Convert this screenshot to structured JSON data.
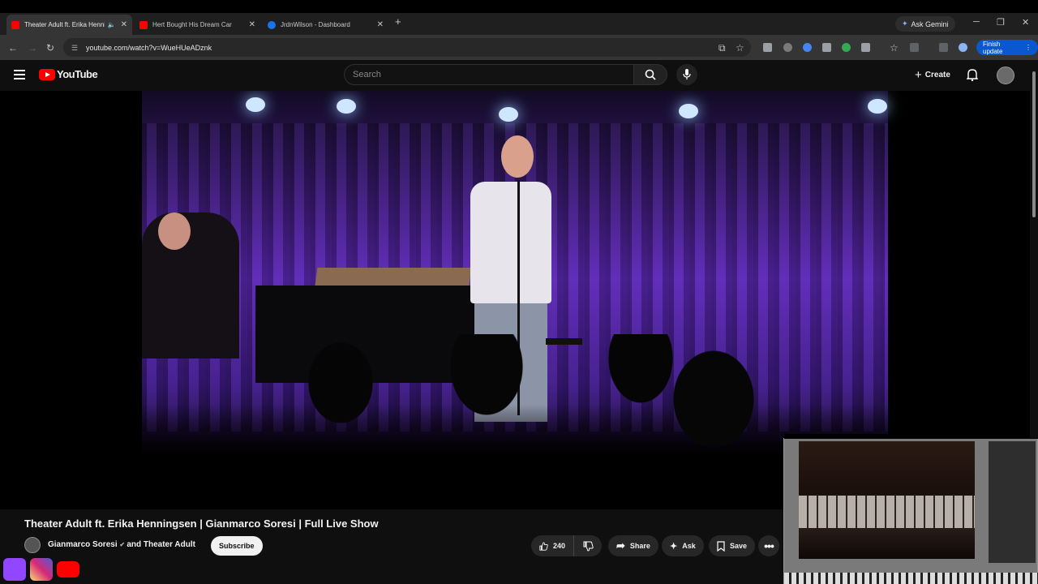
{
  "browser": {
    "tabs": [
      {
        "title": "Theater Adult ft. Erika Henningsen",
        "color": "#ff0000"
      },
      {
        "title": "Hert Bought His Dream Car",
        "color": "#ff0000"
      },
      {
        "title": "JrdnWilson - Dashboard",
        "color": "#1a73e8"
      }
    ],
    "ask_gemini": "Ask Gemini",
    "url": "youtube.com/watch?v=WueHUeADznk",
    "finish_update": "Finish update"
  },
  "youtube": {
    "logo": "YouTube",
    "search_placeholder": "Search",
    "create_label": "Create"
  },
  "video": {
    "title": "Theater Adult ft. Erika Henningsen | Gianmarco Soresi | Full Live Show",
    "channel": "Gianmarco Soresi",
    "channel_suffix": "and Theater Adult",
    "subscribe": "Subscribe",
    "likes": "240",
    "share": "Share",
    "ask": "Ask",
    "save": "Save"
  },
  "colors": {
    "brand_red": "#ff0000",
    "accent_blue": "#0b57d0",
    "twitch": "#9146ff",
    "instagram": "#e1306c"
  }
}
